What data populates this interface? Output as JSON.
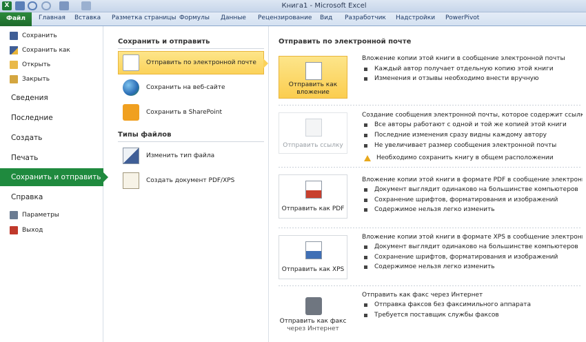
{
  "window": {
    "title": "Книга1  -  Microsoft Excel"
  },
  "ribbon": {
    "tabs": [
      "Файл",
      "Главная",
      "Вставка",
      "Разметка страницы",
      "Формулы",
      "Данные",
      "Рецензирование",
      "Вид",
      "Разработчик",
      "Надстройки",
      "PowerPivot"
    ]
  },
  "nav": {
    "small_top": [
      "Сохранить",
      "Сохранить как",
      "Открыть",
      "Закрыть"
    ],
    "big": [
      "Сведения",
      "Последние",
      "Создать",
      "Печать"
    ],
    "active": "Сохранить и отправить",
    "help": "Справка",
    "small_bottom": [
      "Параметры",
      "Выход"
    ]
  },
  "middle": {
    "section1_title": "Сохранить и отправить",
    "section1_items": [
      "Отправить по электронной почте",
      "Сохранить на веб-сайте",
      "Сохранить в SharePoint"
    ],
    "section2_title": "Типы файлов",
    "section2_items": [
      "Изменить тип файла",
      "Создать документ PDF/XPS"
    ]
  },
  "right": {
    "title": "Отправить по электронной почте",
    "blocks": [
      {
        "button": [
          "Отправить как",
          "вложение"
        ],
        "desc": "Вложение копии этой книги в сообщение электронной почты",
        "bullets": [
          "Каждый автор получает отдельную копию этой книги",
          "Изменения и отзывы необходимо внести вручную"
        ]
      },
      {
        "button": [
          "Отправить ссылку"
        ],
        "desc": "Создание сообщения электронной почты, которое содержит ссылку на эт",
        "bullets": [
          "Все авторы работают с одной и той же копией этой книги",
          "Последние изменения сразу видны каждому автору",
          "Не увеличивает размер сообщения электронной почты"
        ],
        "warning": "Необходимо сохранить книгу в общем расположении"
      },
      {
        "button": [
          "Отправить как PDF"
        ],
        "desc": "Вложение копии этой книги в формате PDF в сообщение электронной по",
        "bullets": [
          "Документ выглядит одинаково на большинстве компьютеров",
          "Сохранение шрифтов, форматирования и изображений",
          "Содержимое нельзя легко изменить"
        ]
      },
      {
        "button": [
          "Отправить как XPS"
        ],
        "desc": "Вложение копии этой книги в формате XPS в сообщение электронной по",
        "bullets": [
          "Документ выглядит одинаково на большинстве компьютеров",
          "Сохранение шрифтов, форматирования и изображений",
          "Содержимое нельзя легко изменить"
        ]
      },
      {
        "button": [
          "Отправить как факс",
          "через Интернет"
        ],
        "desc": "Отправить как факс через Интернет",
        "bullets": [
          "Отправка факсов без факсимильного аппарата",
          "Требуется поставщик службы факсов"
        ]
      }
    ]
  },
  "colors": {
    "file_tab": "#1f8a3e",
    "selected_option": "#fbd25a",
    "nav_active": "#1f8a3e"
  }
}
